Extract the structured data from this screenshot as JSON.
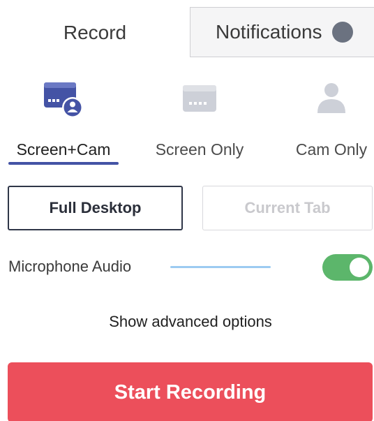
{
  "tabs": {
    "record": "Record",
    "notifications": "Notifications"
  },
  "modes": {
    "screen_cam": {
      "label": "Screen+Cam",
      "icon": "screen-cam-icon",
      "selected": true
    },
    "screen_only": {
      "label": "Screen Only",
      "icon": "screen-icon",
      "selected": false
    },
    "cam_only": {
      "label": "Cam Only",
      "icon": "person-icon",
      "selected": false
    }
  },
  "source": {
    "full_desktop": "Full Desktop",
    "current_tab": "Current Tab",
    "selected": "Full Desktop"
  },
  "microphone": {
    "label": "Microphone Audio",
    "enabled": true
  },
  "advanced": "Show advanced options",
  "start_button": "Start Recording",
  "colors": {
    "accent": "#4453a5",
    "start": "#ec4f5b",
    "toggle_on": "#5cb66b",
    "mic_level": "#9ccbf1"
  }
}
